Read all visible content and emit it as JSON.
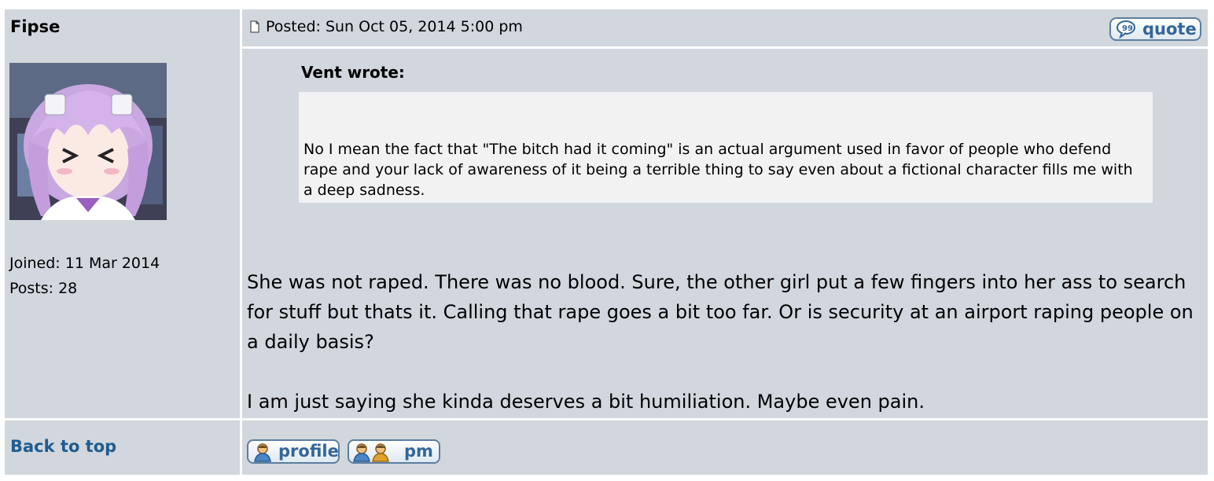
{
  "post": {
    "author": {
      "username": "Fipse",
      "joined": "Joined: 11 Mar 2014",
      "posts": "Posts: 28"
    },
    "header": {
      "posted": "Posted: Sun Oct 05, 2014 5:00 pm",
      "quote_label": "quote"
    },
    "quote": {
      "author": "Vent wrote:",
      "text": "No I mean the fact that \"The bitch had it coming\" is an actual argument used in favor of people who defend rape and your lack of awareness of it being a terrible thing to say even about a fictional character fills me with a deep sadness."
    },
    "body": {
      "paragraph1": "She was not raped. There was no blood. Sure, the other girl put a few fingers into her ass to search for stuff but thats it. Calling that rape goes a bit too far. Or is security at an airport raping people on a daily basis?",
      "paragraph2": "I am just saying she kinda deserves a bit humiliation. Maybe even pain."
    },
    "footer": {
      "back_to_top": "Back to top",
      "profile_label": "profile",
      "pm_label": "pm"
    }
  },
  "colors": {
    "row_background": "#d1d7dc",
    "quote_background": "#f2f2f2",
    "link": "#1e5c8f",
    "button_text": "#336699",
    "button_border": "#5b7ea0"
  },
  "icons": {
    "post": "post-page-icon",
    "quote": "speech-bubble-icon",
    "profile": "person-icon",
    "pm": "two-people-icon"
  }
}
